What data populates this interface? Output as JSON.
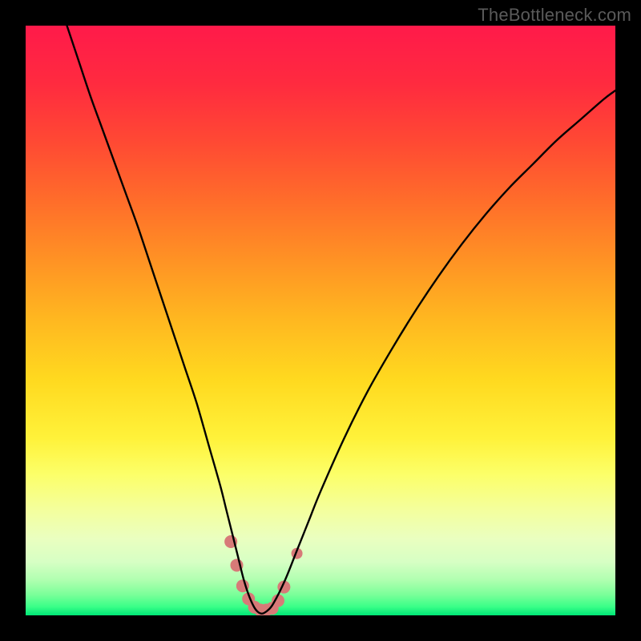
{
  "watermark_text": "TheBottleneck.com",
  "chart_data": {
    "type": "line",
    "title": "",
    "xlabel": "",
    "ylabel": "",
    "xlim": [
      0,
      100
    ],
    "ylim": [
      0,
      100
    ],
    "gradient": {
      "stops": [
        {
          "offset": 0.0,
          "color": "#ff1a4a"
        },
        {
          "offset": 0.1,
          "color": "#ff2b3f"
        },
        {
          "offset": 0.2,
          "color": "#ff4a33"
        },
        {
          "offset": 0.3,
          "color": "#ff6e2a"
        },
        {
          "offset": 0.4,
          "color": "#ff9324"
        },
        {
          "offset": 0.5,
          "color": "#ffb820"
        },
        {
          "offset": 0.6,
          "color": "#ffd91f"
        },
        {
          "offset": 0.7,
          "color": "#fff23a"
        },
        {
          "offset": 0.76,
          "color": "#fcff68"
        },
        {
          "offset": 0.82,
          "color": "#f4ff9c"
        },
        {
          "offset": 0.87,
          "color": "#eaffc0"
        },
        {
          "offset": 0.91,
          "color": "#d6ffc4"
        },
        {
          "offset": 0.94,
          "color": "#b0ffb0"
        },
        {
          "offset": 0.965,
          "color": "#7aff99"
        },
        {
          "offset": 0.985,
          "color": "#3bff88"
        },
        {
          "offset": 1.0,
          "color": "#00e676"
        }
      ]
    },
    "series": [
      {
        "name": "bottleneck-curve",
        "color": "#000000",
        "x": [
          7,
          9,
          11,
          13,
          15,
          17,
          19,
          21,
          23,
          25,
          27,
          29,
          31,
          33,
          34,
          35,
          36,
          37,
          38,
          39,
          40,
          41,
          42,
          44,
          46,
          48,
          50,
          54,
          58,
          62,
          66,
          70,
          74,
          78,
          82,
          86,
          90,
          94,
          98,
          100
        ],
        "y": [
          100,
          94,
          88,
          82.5,
          77,
          71.5,
          66,
          60,
          54,
          48,
          42,
          36,
          29,
          22,
          18,
          14,
          10,
          6,
          3,
          1,
          0.3,
          0.8,
          2,
          6,
          11,
          16,
          21,
          30,
          38,
          45,
          51.5,
          57.5,
          63,
          68,
          72.5,
          76.5,
          80.5,
          84,
          87.5,
          89
        ]
      }
    ],
    "markers": {
      "name": "highlight-region",
      "color": "#d77a78",
      "points": [
        {
          "x": 34.8,
          "y": 12.5,
          "r": 8
        },
        {
          "x": 35.8,
          "y": 8.5,
          "r": 8
        },
        {
          "x": 36.8,
          "y": 5.0,
          "r": 8
        },
        {
          "x": 37.8,
          "y": 2.8,
          "r": 8
        },
        {
          "x": 38.8,
          "y": 1.4,
          "r": 8
        },
        {
          "x": 39.8,
          "y": 0.9,
          "r": 8
        },
        {
          "x": 40.8,
          "y": 0.9,
          "r": 8
        },
        {
          "x": 41.8,
          "y": 1.2,
          "r": 8
        },
        {
          "x": 42.8,
          "y": 2.5,
          "r": 8
        },
        {
          "x": 43.8,
          "y": 4.8,
          "r": 8
        },
        {
          "x": 46.0,
          "y": 10.5,
          "r": 7
        }
      ]
    }
  }
}
